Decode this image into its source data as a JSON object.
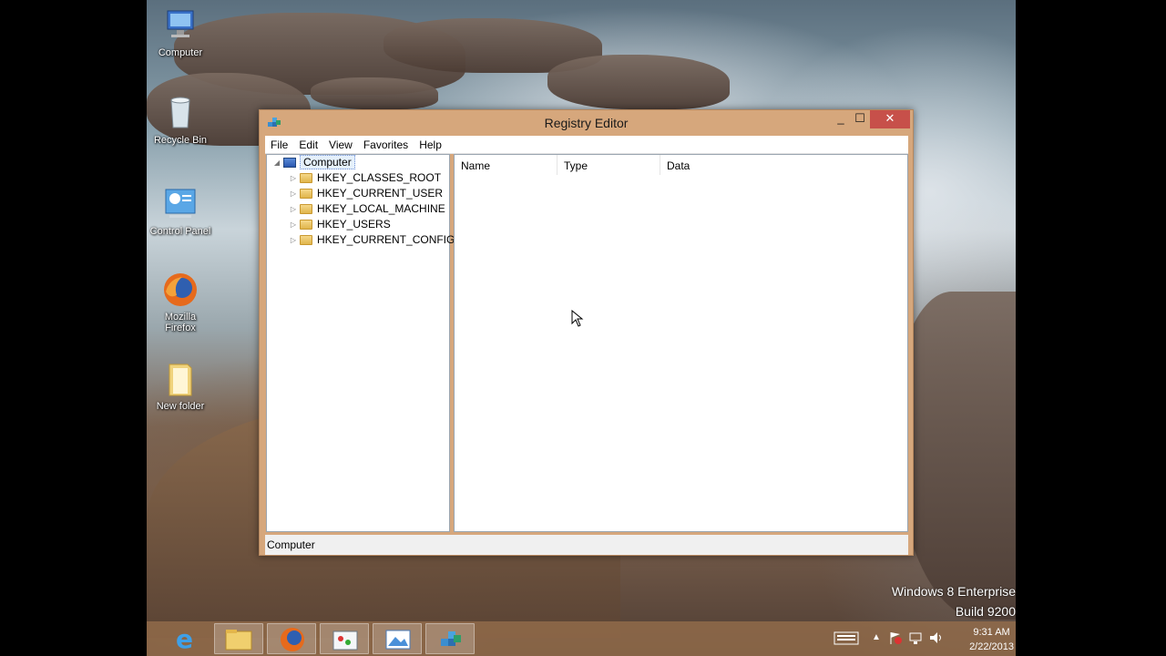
{
  "desktop": {
    "icons": [
      {
        "label": "Computer"
      },
      {
        "label": "Recycle Bin"
      },
      {
        "label": "Control Panel"
      },
      {
        "label": "Mozilla Firefox"
      },
      {
        "label": "New folder"
      }
    ],
    "watermark_line1": "Windows 8 Enterprise",
    "watermark_line2": "Build 9200"
  },
  "window": {
    "title": "Registry Editor",
    "minimize": "_",
    "maximize": "☐",
    "close": "✕",
    "menu": [
      "File",
      "Edit",
      "View",
      "Favorites",
      "Help"
    ],
    "tree": {
      "root": "Computer",
      "children": [
        "HKEY_CLASSES_ROOT",
        "HKEY_CURRENT_USER",
        "HKEY_LOCAL_MACHINE",
        "HKEY_USERS",
        "HKEY_CURRENT_CONFIG"
      ]
    },
    "columns": [
      "Name",
      "Type",
      "Data"
    ],
    "status": "Computer"
  },
  "taskbar": {
    "items": [
      "internet-explorer",
      "file-explorer",
      "firefox",
      "paint",
      "picture-viewer",
      "registry-editor"
    ],
    "clock_time": "9:31 AM",
    "clock_date": "2/22/2013"
  },
  "colors": {
    "window_frame": "#d6a77c",
    "close_button": "#c7504a",
    "taskbar": "#96704b"
  }
}
